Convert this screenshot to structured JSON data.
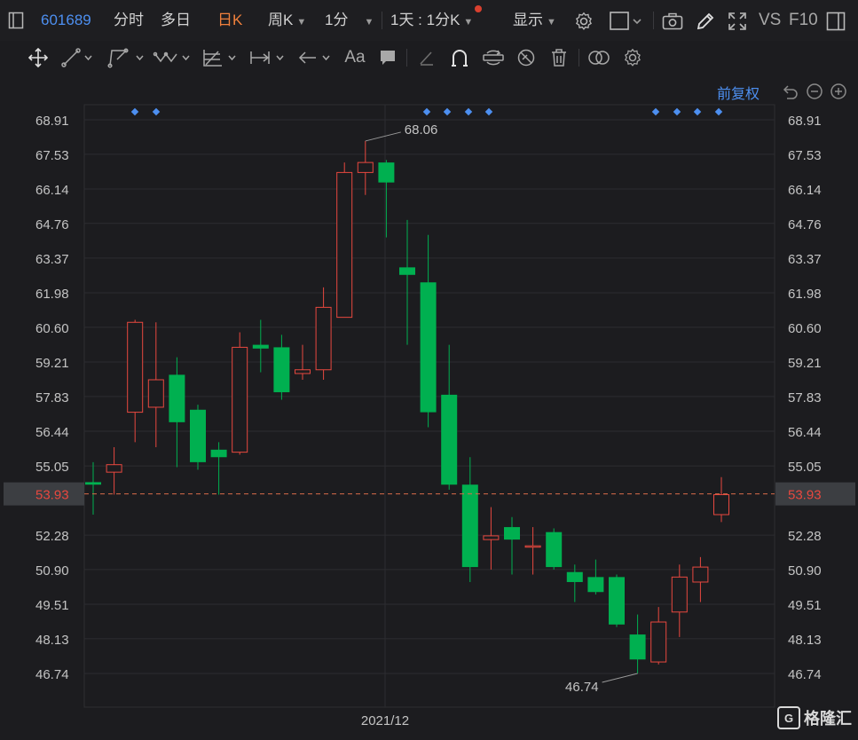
{
  "toolbar": {
    "code": "601689",
    "tabs": [
      "分时",
      "多日",
      "日K",
      "周K",
      "1分"
    ],
    "active_tab": "日K",
    "period_label": "1天 : 1分K",
    "display_label": "显示",
    "vs_label": "VS",
    "f10_label": "F10"
  },
  "adjust_label": "前复权",
  "brand": "格隆汇",
  "colors": {
    "up": "#e8483f",
    "down": "#00b050",
    "accent": "#4d8ff0",
    "active_tab": "#f0803c",
    "current_price_line": "#d86b4a"
  },
  "chart_data": {
    "type": "candlestick",
    "x_tick_label": "2021/12",
    "y_ticks": [
      68.91,
      67.53,
      66.14,
      64.76,
      63.37,
      61.98,
      60.6,
      59.21,
      57.83,
      56.44,
      55.05,
      53.93,
      52.28,
      50.9,
      49.51,
      48.13,
      46.74
    ],
    "ylim": [
      45.2,
      70.1
    ],
    "current_price": 53.93,
    "max_label": "68.06",
    "min_label": "46.74",
    "max_value": 68.06,
    "min_value": 46.74,
    "candles": [
      {
        "o": 54.4,
        "c": 54.3,
        "h": 55.2,
        "l": 53.1
      },
      {
        "o": 54.8,
        "c": 55.1,
        "h": 55.8,
        "l": 53.9
      },
      {
        "o": 57.2,
        "c": 60.8,
        "h": 60.9,
        "l": 56.0
      },
      {
        "o": 57.4,
        "c": 58.5,
        "h": 60.8,
        "l": 55.8
      },
      {
        "o": 58.7,
        "c": 56.8,
        "h": 59.4,
        "l": 55.0
      },
      {
        "o": 57.3,
        "c": 55.2,
        "h": 57.5,
        "l": 54.9
      },
      {
        "o": 55.7,
        "c": 55.4,
        "h": 56.0,
        "l": 53.9
      },
      {
        "o": 55.6,
        "c": 59.8,
        "h": 60.4,
        "l": 55.5
      },
      {
        "o": 59.9,
        "c": 59.75,
        "h": 60.9,
        "l": 58.8
      },
      {
        "o": 59.8,
        "c": 58.0,
        "h": 60.3,
        "l": 57.7
      },
      {
        "o": 58.75,
        "c": 58.9,
        "h": 59.9,
        "l": 58.5
      },
      {
        "o": 58.9,
        "c": 61.4,
        "h": 62.2,
        "l": 58.5
      },
      {
        "o": 61.0,
        "c": 66.8,
        "h": 67.2,
        "l": 61.0
      },
      {
        "o": 66.8,
        "c": 67.2,
        "h": 68.06,
        "l": 65.9
      },
      {
        "o": 67.2,
        "c": 66.4,
        "h": 67.3,
        "l": 64.2
      },
      {
        "o": 63.0,
        "c": 62.7,
        "h": 64.9,
        "l": 59.9
      },
      {
        "o": 62.4,
        "c": 57.2,
        "h": 64.3,
        "l": 56.6
      },
      {
        "o": 57.9,
        "c": 54.3,
        "h": 59.9,
        "l": 54.1
      },
      {
        "o": 54.3,
        "c": 51.0,
        "h": 55.4,
        "l": 50.4
      },
      {
        "o": 52.1,
        "c": 52.25,
        "h": 53.4,
        "l": 50.9
      },
      {
        "o": 52.6,
        "c": 52.1,
        "h": 53.0,
        "l": 50.7
      },
      {
        "o": 51.85,
        "c": 51.85,
        "h": 52.6,
        "l": 50.7
      },
      {
        "o": 52.4,
        "c": 51.0,
        "h": 52.55,
        "l": 50.9
      },
      {
        "o": 50.8,
        "c": 50.4,
        "h": 51.1,
        "l": 49.6
      },
      {
        "o": 50.6,
        "c": 50.0,
        "h": 51.3,
        "l": 49.9
      },
      {
        "o": 50.6,
        "c": 48.7,
        "h": 50.7,
        "l": 48.6
      },
      {
        "o": 48.3,
        "c": 47.3,
        "h": 49.1,
        "l": 46.74
      },
      {
        "o": 47.2,
        "c": 48.8,
        "h": 49.4,
        "l": 47.1
      },
      {
        "o": 49.2,
        "c": 50.6,
        "h": 51.1,
        "l": 48.2
      },
      {
        "o": 50.4,
        "c": 51.0,
        "h": 51.4,
        "l": 49.6
      },
      {
        "o": 53.1,
        "c": 53.9,
        "h": 54.6,
        "l": 52.8
      }
    ]
  }
}
